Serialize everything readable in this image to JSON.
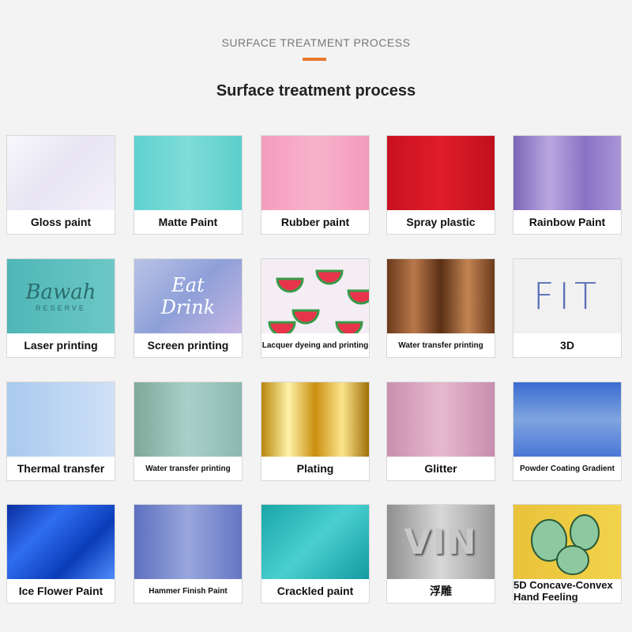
{
  "header": {
    "subtitle": "SURFACE TREATMENT PROCESS",
    "title": "Surface treatment process",
    "accent_color": "#e8792c"
  },
  "tiles": [
    {
      "label": "Gloss paint",
      "swatch": "linear-gradient(135deg,#f8f8fc 0%,#e8e4f4 50%,#f4f2fb 100%)"
    },
    {
      "label": "Matte Paint",
      "swatch": "linear-gradient(90deg,#5fd3cf,#7fdcd8,#5bcfca)"
    },
    {
      "label": "Rubber paint",
      "swatch": "linear-gradient(90deg,#f49cbd,#f8b3cb,#f39abb)"
    },
    {
      "label": "Spray plastic",
      "swatch": "linear-gradient(90deg,#c9111f,#e01d2a,#c0101c)"
    },
    {
      "label": "Rainbow Paint",
      "swatch": "linear-gradient(90deg,#7c66b8,#b9a7e0,#8a72c4,#a996d6)"
    },
    {
      "label": "Laser printing",
      "swatch": "linear-gradient(90deg,#4fb6b6,#6cc8c6)",
      "art_text": "Bawah",
      "art_sub": "RESERVE"
    },
    {
      "label": "Screen printing",
      "swatch": "linear-gradient(135deg,#b9c3e6,#8ea0d8,#c7b6e4)",
      "art_text": "Eat",
      "art_sub": "Drink"
    },
    {
      "label": "Lacquer dyeing and printing",
      "swatch": "#f4eef4",
      "small": true
    },
    {
      "label": "Water transfer printing",
      "swatch": "linear-gradient(90deg,#6b3a1c,#b9784a,#5a2f14,#c48553,#6b3a1c)",
      "small": true
    },
    {
      "label": "3D",
      "swatch": "#f1f1f1",
      "art_text": "FIT"
    },
    {
      "label": "Thermal transfer",
      "swatch": "linear-gradient(90deg,#a9c9ee,#cfe1f6)"
    },
    {
      "label": "Water transfer printing",
      "swatch": "linear-gradient(90deg,#7fa89a,#a8d0c8,#8bb8b0)",
      "small": true
    },
    {
      "label": "Plating",
      "swatch": "linear-gradient(90deg,#b8860b,#fff2a8,#c98f10,#fce58b,#a0700a)"
    },
    {
      "label": "Glitter",
      "swatch": "linear-gradient(90deg,#c98fae,#e7b9cf,#c88dac)"
    },
    {
      "label": "Powder Coating Gradient",
      "swatch": "linear-gradient(180deg,#3a6bd0,#7fa4e0,#4a77d6)",
      "small": true
    },
    {
      "label": "Ice Flower Paint",
      "swatch": "linear-gradient(135deg,#0a2f9e,#2f6ef0,#0b3cb8,#4f8cff)"
    },
    {
      "label": "Hammer Finish Paint",
      "swatch": "linear-gradient(90deg,#5e70c0,#98a6dc,#6576c4)",
      "small": true
    },
    {
      "label": "Crackled paint",
      "swatch": "linear-gradient(135deg,#1aa6a8,#49cfcf,#139aa0)"
    },
    {
      "label": "浮雕",
      "swatch": "linear-gradient(90deg,#8f8f8f,#d8d8d8,#9a9a9a)",
      "art_text": "VIN"
    },
    {
      "label": "5D Concave-Convex Hand Feeling",
      "swatch": "linear-gradient(90deg,#e9c23a,#f2d34a)",
      "twoline": true
    }
  ]
}
